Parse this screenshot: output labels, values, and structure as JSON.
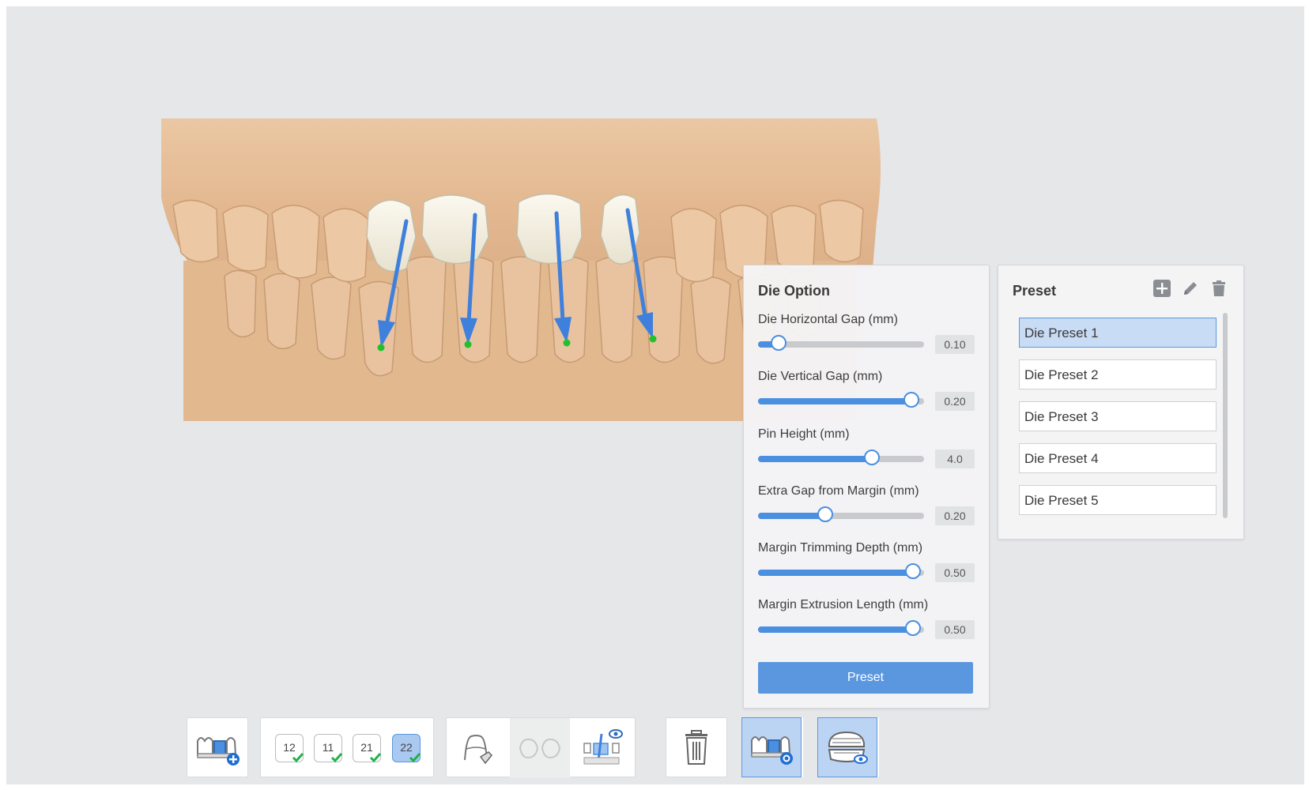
{
  "die_option": {
    "title": "Die Option",
    "sliders": [
      {
        "label": "Die Horizontal Gap (mm)",
        "value_text": "0.10",
        "fraction": 0.13
      },
      {
        "label": "Die Vertical Gap (mm)",
        "value_text": "0.20",
        "fraction": 0.93
      },
      {
        "label": "Pin Height (mm)",
        "value_text": "4.0",
        "fraction": 0.69
      },
      {
        "label": "Extra Gap from Margin (mm)",
        "value_text": "0.20",
        "fraction": 0.41
      },
      {
        "label": "Margin Trimming Depth (mm)",
        "value_text": "0.50",
        "fraction": 0.94
      },
      {
        "label": "Margin Extrusion Length (mm)",
        "value_text": "0.50",
        "fraction": 0.94
      }
    ],
    "preset_button": "Preset"
  },
  "preset_panel": {
    "title": "Preset",
    "items": [
      "Die Preset 1",
      "Die Preset 2",
      "Die Preset 3",
      "Die Preset 4",
      "Die Preset 5"
    ],
    "selected_index": 0,
    "action_icons": [
      "add-icon",
      "edit-icon",
      "delete-icon"
    ]
  },
  "toolbar": {
    "teeth": [
      "12",
      "11",
      "21",
      "22"
    ],
    "active_tooth": "22",
    "tools": [
      "add-die-icon",
      "margin-tool-icon",
      "hide-tool-icon",
      "view-path-icon",
      "delete-icon",
      "die-settings-icon",
      "show-model-icon"
    ]
  },
  "colors": {
    "accent": "#4a8fe0",
    "model": "#e7c09c",
    "die": "#f1ede0",
    "direction_arrow": "#3f80dc",
    "margin_point": "#22c02a"
  }
}
